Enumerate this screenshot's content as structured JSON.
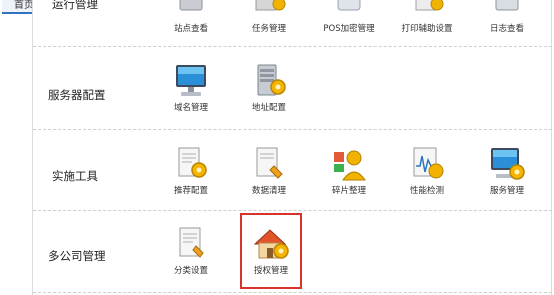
{
  "tabs": {
    "home": "首页"
  },
  "categories": {
    "ops": "运行管理",
    "service_config": "服务器配置",
    "implement": "实施工具",
    "multi_company": "多公司管理"
  },
  "tools": {
    "site_view": "站点查看",
    "task_manage": "任务管理",
    "pos_encrypt": "POS加密管理",
    "print_settings": "打印辅助设置",
    "log_view": "日志查看",
    "domain_manage": "域名管理",
    "address_config": "地址配置",
    "recommend_config": "推荐配置",
    "data_cleanup": "数据清理",
    "fragment_cleanup": "碎片整理",
    "performance_test": "性能检测",
    "service_manage": "服务管理",
    "category_settings": "分类设置",
    "auth_manage": "授权管理"
  },
  "highlight_color": "#d9342b",
  "accent_color": "#2f74c0"
}
